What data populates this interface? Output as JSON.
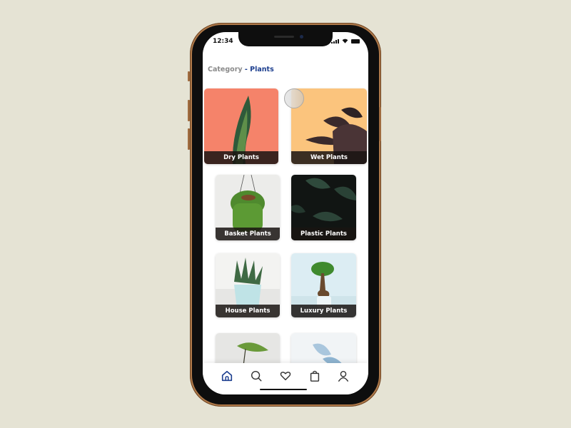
{
  "status_bar": {
    "time": "12:34",
    "signal_icon": "cellular-signal-icon",
    "wifi_icon": "wifi-icon",
    "battery_icon": "battery-icon"
  },
  "breadcrumb": {
    "parent": "Category",
    "separator": " - ",
    "current": "Plants"
  },
  "colors": {
    "accent": "#1d3f8f",
    "muted": "#8a8a8a",
    "background": "#e5e3d4",
    "phone_frame": "#b07a4a"
  },
  "categories": [
    {
      "label": "Dry Plants"
    },
    {
      "label": "Wet Plants"
    },
    {
      "label": "Basket Plants"
    },
    {
      "label": "Plastic Plants"
    },
    {
      "label": "House Plants"
    },
    {
      "label": "Luxury Plants"
    },
    {
      "label": ""
    },
    {
      "label": ""
    }
  ],
  "bottom_nav": {
    "active": "home",
    "items": [
      {
        "name": "home",
        "icon": "home-icon"
      },
      {
        "name": "search",
        "icon": "search-icon"
      },
      {
        "name": "favorites",
        "icon": "heart-icon"
      },
      {
        "name": "cart",
        "icon": "shopping-bag-icon"
      },
      {
        "name": "profile",
        "icon": "user-icon"
      }
    ]
  }
}
